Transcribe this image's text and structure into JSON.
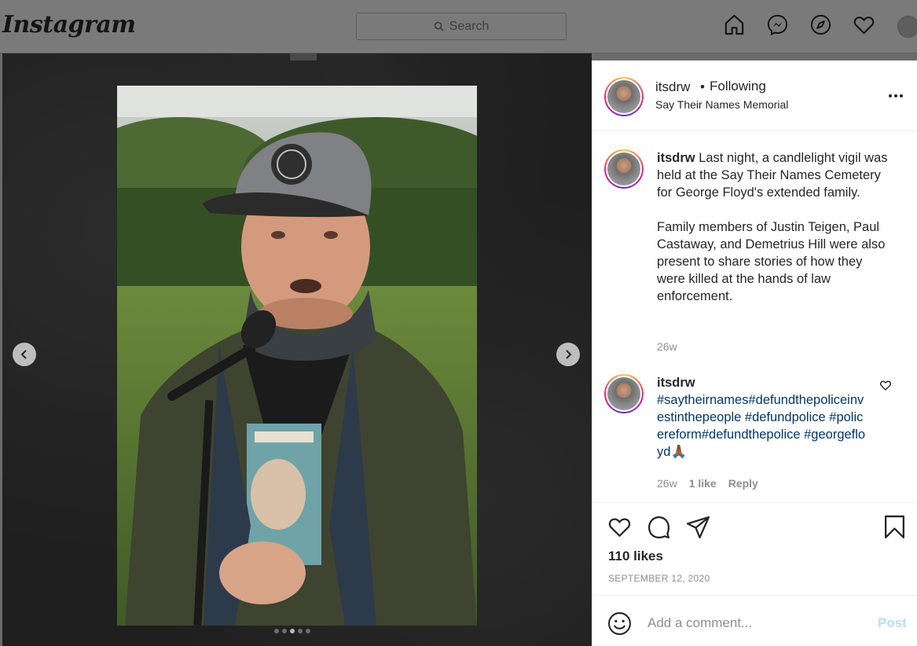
{
  "nav": {
    "logo": "Instagram",
    "search_placeholder": "Search",
    "icons": [
      "home-icon",
      "messenger-icon",
      "explore-icon",
      "activity-heart-icon",
      "profile-avatar"
    ]
  },
  "media": {
    "carousel_dots": 5,
    "active_dot": 2,
    "prev_icon": "chevron-left-icon",
    "next_icon": "chevron-right-icon"
  },
  "post": {
    "username": "itsdrw",
    "separator": "•",
    "follow_status": "Following",
    "location": "Say Their Names Memorial",
    "caption_p1": "Last night, a candlelight vigil was held at the Say Their Names Cemetery for George Floyd's extended family.",
    "caption_p2": "Family members of Justin Teigen, Paul Castaway, and Demetrius Hill were also present to share stories of how they were killed at the hands of law enforcement.",
    "caption_age": "26w",
    "comment": {
      "username": "itsdrw",
      "tags": "#saytheirnames#defundthepoliceinvestinthepeople #defundpolice #policereform#defundthepolice #georgefloyd",
      "emoji": "🙏🏾",
      "age": "26w",
      "likes": "1 like",
      "reply": "Reply"
    },
    "likes": "110 likes",
    "date": "SEPTEMBER 12, 2020",
    "add_comment_placeholder": "Add a comment...",
    "post_button": "Post"
  },
  "colors": {
    "link": "#00376b",
    "muted": "#8e8e8e",
    "post_disabled": "#b2dffc"
  }
}
